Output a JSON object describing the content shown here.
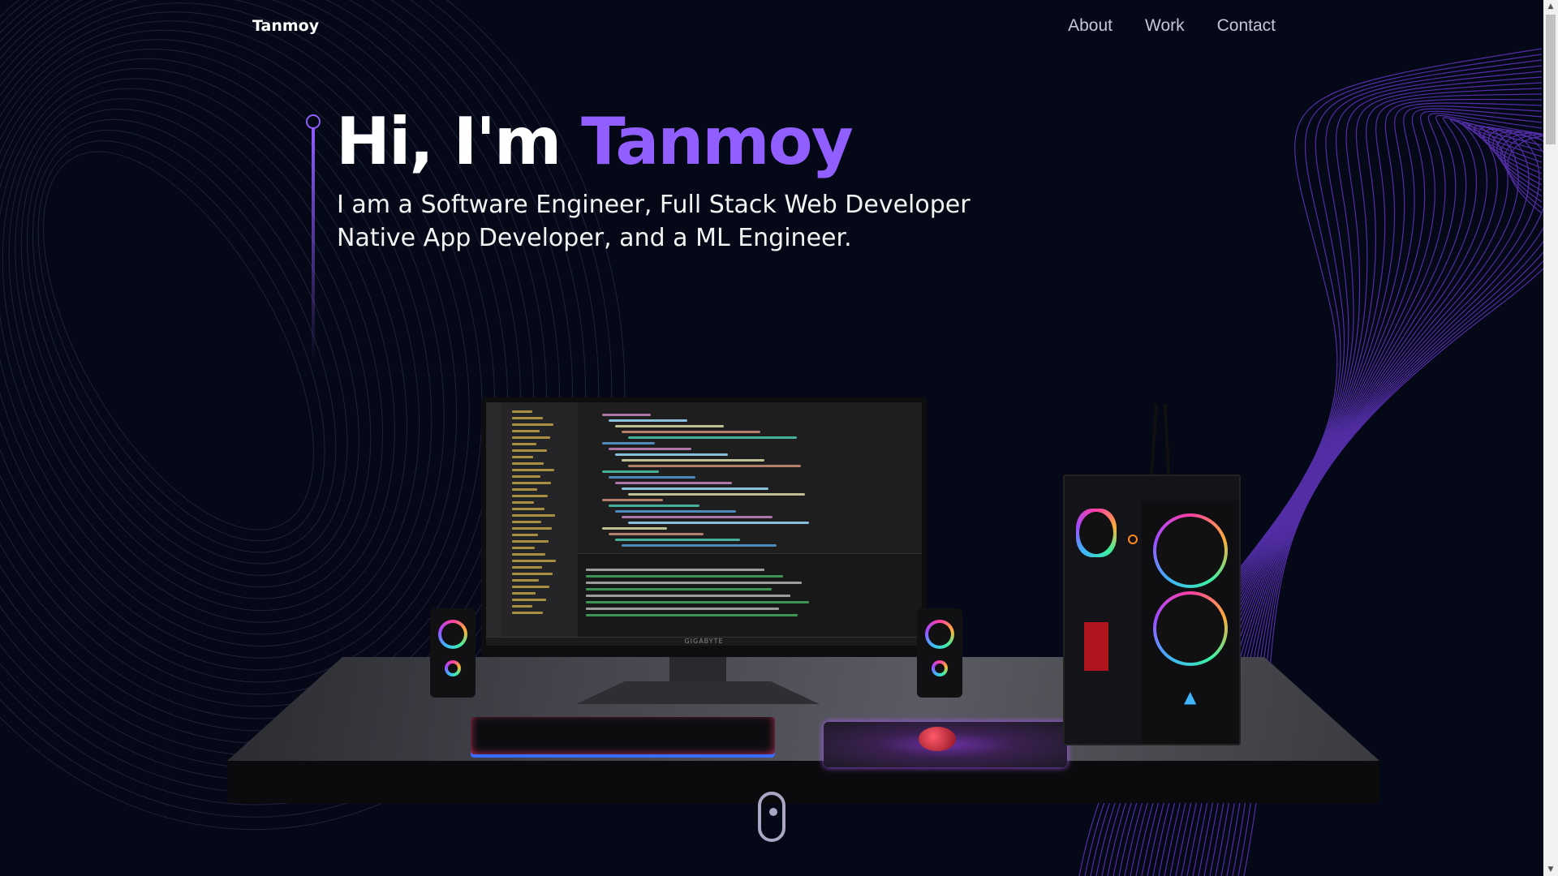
{
  "nav": {
    "logo": "Tanmoy",
    "links": [
      {
        "label": "About"
      },
      {
        "label": "Work"
      },
      {
        "label": "Contact"
      }
    ]
  },
  "hero": {
    "greeting": "Hi, I'm",
    "name": "Tanmoy",
    "subtitle_line1": "I am a Software Engineer, Full Stack Web Developer",
    "subtitle_line2": "Native App Developer, and a ML Engineer.",
    "accent_color": "#915eff"
  },
  "scene": {
    "monitor_brand": "GIGABYTE"
  },
  "colors": {
    "background": "#050816",
    "accent": "#915eff",
    "nav_text": "#c7c6d6",
    "wave": "#6c3bd6"
  },
  "icons": [
    "mouse-scroll-icon",
    "scroll-up-arrow-icon",
    "scroll-down-arrow-icon"
  ]
}
